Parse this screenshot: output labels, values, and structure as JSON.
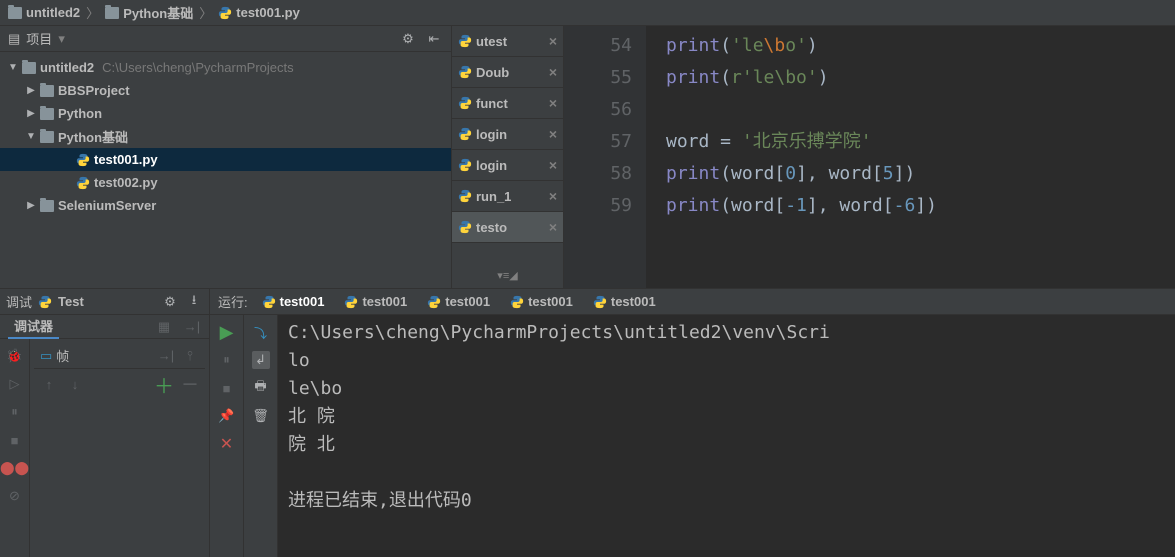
{
  "breadcrumb": [
    {
      "label": "untitled2",
      "icon": "folder"
    },
    {
      "label": "Python基础",
      "icon": "folder"
    },
    {
      "label": "test001.py",
      "icon": "python"
    }
  ],
  "sidebar": {
    "title": "项目",
    "tree": {
      "root": {
        "label": "untitled2",
        "path": "C:\\Users\\cheng\\PycharmProjects"
      },
      "items": [
        {
          "label": "BBSProject",
          "icon": "folder",
          "arrow": "▶",
          "indent": 1
        },
        {
          "label": "Python",
          "icon": "folder",
          "arrow": "▶",
          "indent": 1
        },
        {
          "label": "Python基础",
          "icon": "folder",
          "arrow": "▼",
          "indent": 1
        },
        {
          "label": "test001.py",
          "icon": "python",
          "arrow": "",
          "indent": 3,
          "selected": true
        },
        {
          "label": "test002.py",
          "icon": "python",
          "arrow": "",
          "indent": 3
        },
        {
          "label": "SeleniumServer",
          "icon": "folder",
          "arrow": "▶",
          "indent": 1
        }
      ]
    }
  },
  "tabs": [
    {
      "label": "utest"
    },
    {
      "label": "Doub"
    },
    {
      "label": "funct"
    },
    {
      "label": "login"
    },
    {
      "label": "login"
    },
    {
      "label": "run_1"
    },
    {
      "label": "testo",
      "active": true
    }
  ],
  "editor": {
    "lines": [
      {
        "num": "54",
        "tokens": [
          {
            "t": "print",
            "c": "kw"
          },
          {
            "t": "(",
            "c": ""
          },
          {
            "t": "'le",
            "c": "str"
          },
          {
            "t": "\\b",
            "c": "esc"
          },
          {
            "t": "o'",
            "c": "str"
          },
          {
            "t": ")",
            "c": ""
          }
        ]
      },
      {
        "num": "55",
        "tokens": [
          {
            "t": "print",
            "c": "kw"
          },
          {
            "t": "(",
            "c": ""
          },
          {
            "t": "r'le\\bo'",
            "c": "str"
          },
          {
            "t": ")",
            "c": ""
          }
        ]
      },
      {
        "num": "56",
        "tokens": []
      },
      {
        "num": "57",
        "tokens": [
          {
            "t": "word = ",
            "c": ""
          },
          {
            "t": "'北京乐搏学院'",
            "c": "str"
          }
        ]
      },
      {
        "num": "58",
        "tokens": [
          {
            "t": "print",
            "c": "kw"
          },
          {
            "t": "(word[",
            "c": ""
          },
          {
            "t": "0",
            "c": "num"
          },
          {
            "t": "], word[",
            "c": ""
          },
          {
            "t": "5",
            "c": "num"
          },
          {
            "t": "])",
            "c": ""
          }
        ]
      },
      {
        "num": "59",
        "tokens": [
          {
            "t": "print",
            "c": "kw"
          },
          {
            "t": "(word[",
            "c": ""
          },
          {
            "t": "-1",
            "c": "num"
          },
          {
            "t": "], word[",
            "c": ""
          },
          {
            "t": "-6",
            "c": "num"
          },
          {
            "t": "])",
            "c": ""
          }
        ]
      }
    ]
  },
  "debug": {
    "prefix": "调试",
    "config": "Test",
    "tab_debugger": "调试器",
    "frames_label": "帧"
  },
  "run": {
    "prefix": "运行:",
    "tabs": [
      "test001",
      "test001",
      "test001",
      "test001",
      "test001"
    ],
    "output": [
      "C:\\Users\\cheng\\PycharmProjects\\untitled2\\venv\\Scri",
      "lo",
      "le\\bo",
      "北 院",
      "院 北",
      "",
      "进程已结束,退出代码0"
    ]
  }
}
